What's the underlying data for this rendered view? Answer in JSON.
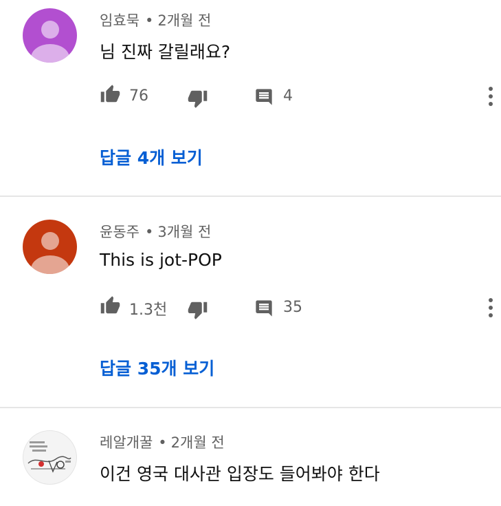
{
  "comments": [
    {
      "author": "임효묵",
      "time": "2개월 전",
      "separator": "•",
      "text": "님 진짜 갈릴래요?",
      "likes": "76",
      "reply_count": "4",
      "replies_label": "답글 4개 보기",
      "avatar_color": "#b24fd0"
    },
    {
      "author": "윤동주",
      "time": "3개월 전",
      "separator": "•",
      "text": "This is jot-POP",
      "likes": "1.3천",
      "reply_count": "35",
      "replies_label": "답글 35개 보기",
      "avatar_color": "#c4380f"
    },
    {
      "author": "레알개꿀",
      "time": "2개월 전",
      "separator": "•",
      "text": "이건 영국 대사관 입장도 들어봐야 한다",
      "avatar_color": "#f4f4f4"
    }
  ],
  "icons": {
    "like": "thumb-up-icon",
    "dislike": "thumb-down-icon",
    "reply": "comment-icon",
    "more": "more-vert-icon"
  },
  "colors": {
    "link": "#065fd4",
    "secondary_text": "#606060",
    "divider": "#e5e5e5"
  }
}
